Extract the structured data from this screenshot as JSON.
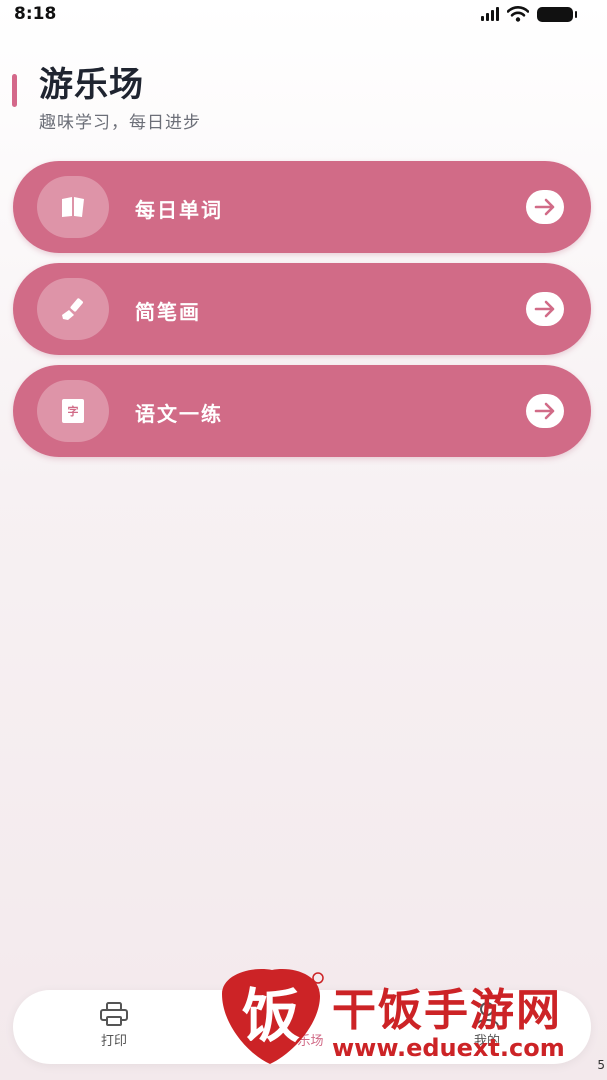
{
  "status_bar": {
    "time": "8:18"
  },
  "header": {
    "title": "游乐场",
    "subtitle": "趣味学习，每日进步"
  },
  "cards": [
    {
      "label": "每日单词",
      "icon": "book-icon"
    },
    {
      "label": "简笔画",
      "icon": "brush-icon"
    },
    {
      "label": "语文一练",
      "icon": "character-icon",
      "icon_text": "字"
    }
  ],
  "tabbar": {
    "tabs": [
      {
        "label": "打印",
        "icon": "printer-icon",
        "active": false
      },
      {
        "label": "游乐场",
        "icon": "playground-icon",
        "active": true
      },
      {
        "label": "我的",
        "icon": "profile-icon",
        "active": false
      }
    ]
  },
  "watermark": {
    "title": "干饭手游网",
    "url": "www.eduext.com",
    "logo_text": "饭"
  },
  "corner_number": "5",
  "colors": {
    "accent": "#d16b87",
    "title": "#1f2430",
    "watermark": "#cc2326"
  }
}
